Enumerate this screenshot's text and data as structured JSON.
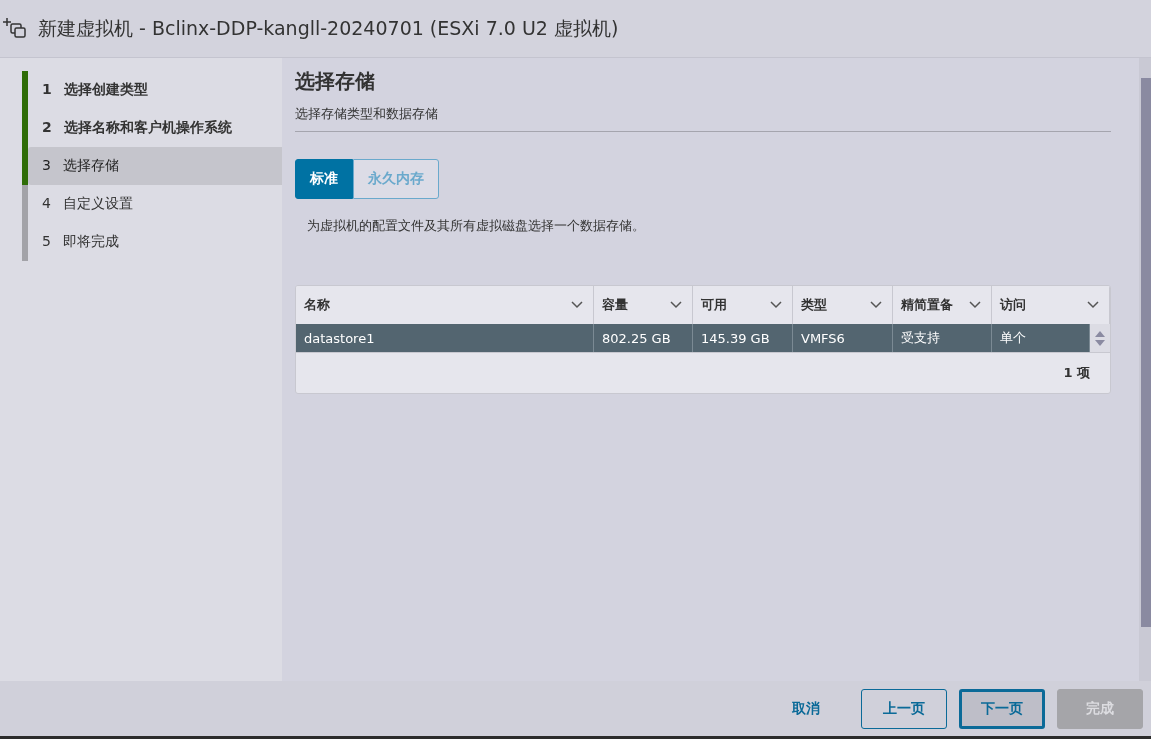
{
  "window": {
    "title": "新建虚拟机 - Bclinx-DDP-kangll-20240701 (ESXi 7.0 U2 虚拟机)"
  },
  "steps": [
    {
      "number": "1",
      "label": "选择创建类型",
      "done": true,
      "selected": false
    },
    {
      "number": "2",
      "label": "选择名称和客户机操作系统",
      "done": true,
      "selected": false
    },
    {
      "number": "3",
      "label": "选择存储",
      "done": true,
      "selected": true
    },
    {
      "number": "4",
      "label": "自定义设置",
      "done": false,
      "selected": false
    },
    {
      "number": "5",
      "label": "即将完成",
      "done": false,
      "selected": false
    }
  ],
  "page": {
    "heading": "选择存储",
    "subtitle": "选择存储类型和数据存储",
    "description": "为虚拟机的配置文件及其所有虚拟磁盘选择一个数据存储。"
  },
  "tabs": [
    {
      "label": "标准",
      "selected": true
    },
    {
      "label": "永久内存",
      "selected": false
    }
  ],
  "table": {
    "columns": [
      "名称",
      "容量",
      "可用",
      "类型",
      "精简置备",
      "访问"
    ],
    "rows": [
      {
        "cells": [
          "datastore1",
          "802.25 GB",
          "145.39 GB",
          "VMFS6",
          "受支持",
          "单个"
        ],
        "selected": true
      }
    ],
    "footer": "1 项"
  },
  "buttons": [
    {
      "label": "取消",
      "kind": "link",
      "disabled": false
    },
    {
      "label": "上一页",
      "kind": "outline",
      "disabled": false
    },
    {
      "label": "下一页",
      "kind": "focused",
      "disabled": false
    },
    {
      "label": "完成",
      "kind": "solid",
      "disabled": true
    }
  ]
}
